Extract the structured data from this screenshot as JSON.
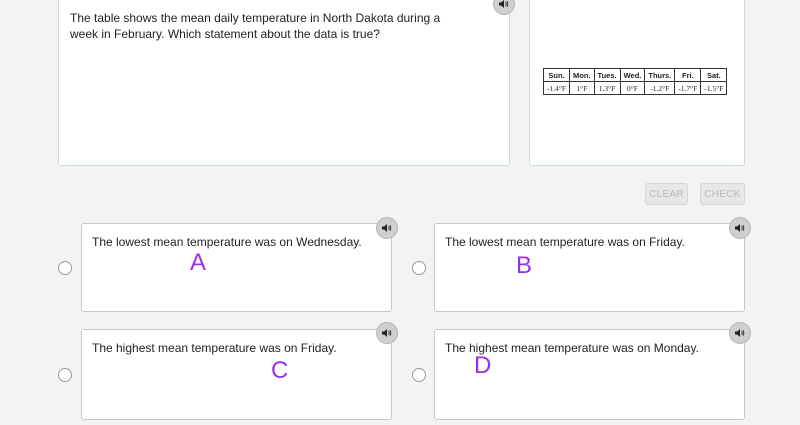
{
  "question": {
    "text": "The table shows the mean daily temperature in North Dakota during a week in February. Which statement about the data is true?"
  },
  "table": {
    "headers": [
      "Sun.",
      "Mon.",
      "Tues.",
      "Wed.",
      "Thurs.",
      "Fri.",
      "Sat."
    ],
    "values": [
      "-1.4°F",
      "1°F",
      "1.3°F",
      "0°F",
      "-1.2°F",
      "-1.7°F",
      "-1.5°F"
    ]
  },
  "toolbar": {
    "clear_label": "CLEAR",
    "check_label": "CHECK"
  },
  "answers": [
    {
      "text": "The lowest mean temperature was on Wednesday.",
      "letter": "A"
    },
    {
      "text": "The lowest mean temperature was on Friday.",
      "letter": "B"
    },
    {
      "text": "The highest mean temperature was on Friday.",
      "letter": "C"
    },
    {
      "text": "The highest mean temperature was on Monday.",
      "letter": "D"
    }
  ],
  "icons": {
    "audio": "speaker-icon",
    "letter_color": "#9b30e3"
  }
}
